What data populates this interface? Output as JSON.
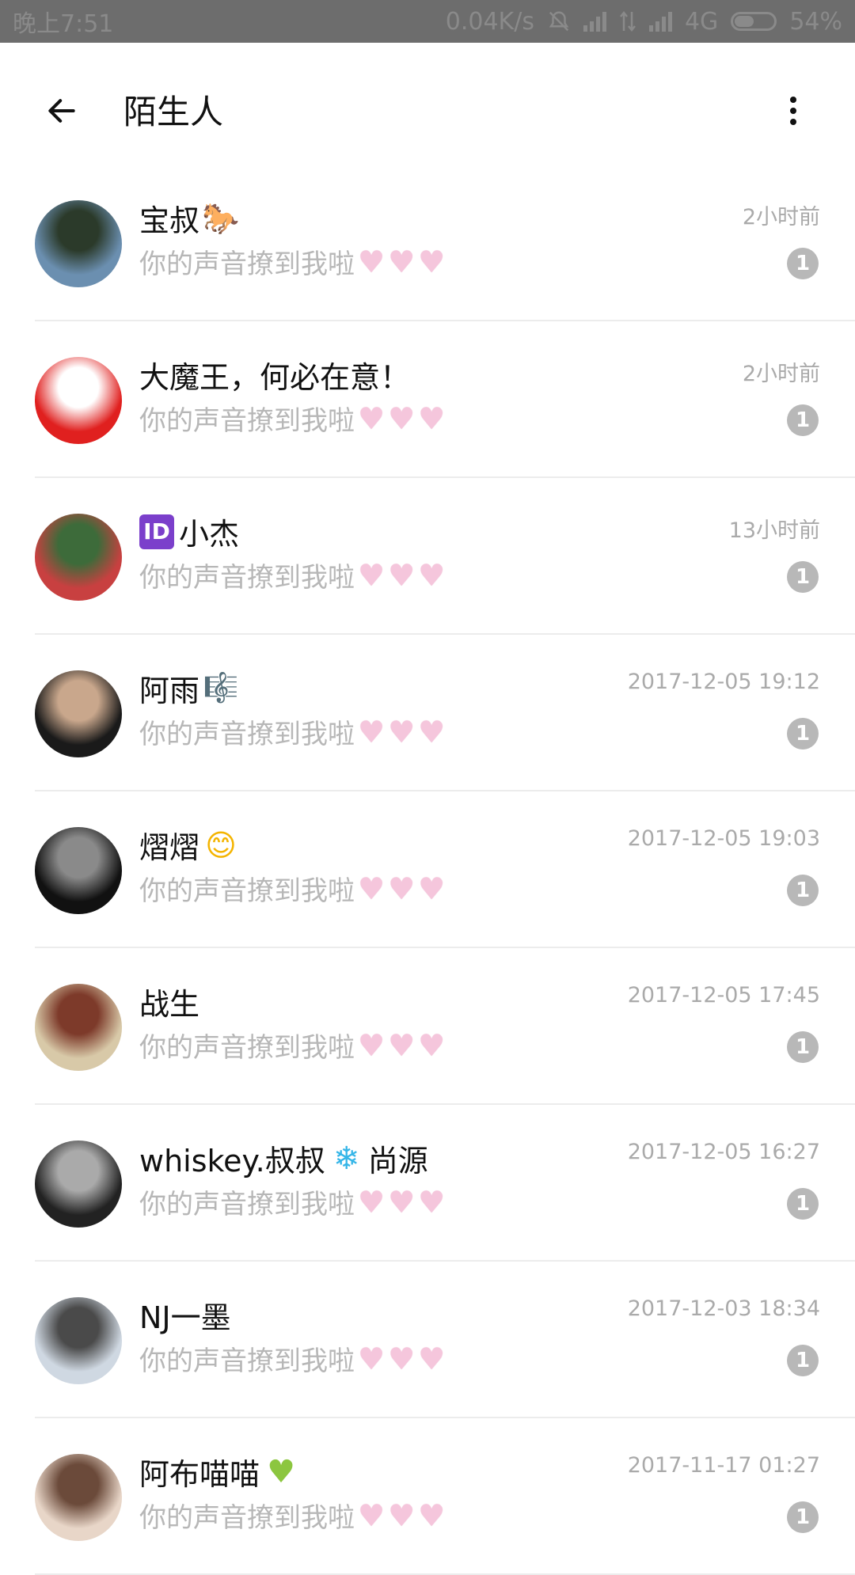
{
  "status_bar": {
    "time": "晚上7:51",
    "net_speed": "0.04K/s",
    "network_type": "4G",
    "battery_percent": "54%",
    "battery_level": 0.54
  },
  "app_bar": {
    "title": "陌生人",
    "back_icon": "arrow-left-icon",
    "more_icon": "more-vertical-icon"
  },
  "conversations": [
    {
      "name": "宝叔",
      "emoji": "🐎",
      "emoji_class": "horse",
      "message": "你的声音撩到我啦",
      "time": "2小时前",
      "unread": "1",
      "avatar_colors": [
        "#6b8fb0",
        "#2b3a2a"
      ]
    },
    {
      "name": "大魔王，何必在意！",
      "emoji": "",
      "emoji_class": "",
      "message": "你的声音撩到我啦",
      "time": "2小时前",
      "unread": "1",
      "avatar_colors": [
        "#e0201f",
        "#ffffff"
      ]
    },
    {
      "name": "小杰",
      "emoji": "ID",
      "emoji_class": "id-badge",
      "emoji_before": true,
      "message": "你的声音撩到我啦",
      "time": "13小时前",
      "unread": "1",
      "avatar_colors": [
        "#c84040",
        "#3d6b3a"
      ]
    },
    {
      "name": "阿雨",
      "emoji": "🎼",
      "emoji_class": "music",
      "message": "你的声音撩到我啦",
      "time": "2017-12-05 19:12",
      "unread": "1",
      "avatar_colors": [
        "#1a1a1a",
        "#c9a78c"
      ]
    },
    {
      "name": "熠熠",
      "emoji": "😊",
      "emoji_class": "smile",
      "message": "你的声音撩到我啦",
      "time": "2017-12-05 19:03",
      "unread": "1",
      "avatar_colors": [
        "#111111",
        "#8a8a8a"
      ]
    },
    {
      "name": "战生",
      "emoji": "",
      "emoji_class": "",
      "message": "你的声音撩到我啦",
      "time": "2017-12-05 17:45",
      "unread": "1",
      "avatar_colors": [
        "#d8c9a8",
        "#7d3a2a"
      ]
    },
    {
      "name": "whiskey.叔叔",
      "emoji": "❄",
      "emoji_class": "snow",
      "name_suffix": "尚源",
      "message": "你的声音撩到我啦",
      "time": "2017-12-05 16:27",
      "unread": "1",
      "avatar_colors": [
        "#222222",
        "#aaaaaa"
      ]
    },
    {
      "name": "NJ一墨",
      "emoji": "",
      "emoji_class": "",
      "message": "你的声音撩到我啦",
      "time": "2017-12-03 18:34",
      "unread": "1",
      "avatar_colors": [
        "#cfd8e2",
        "#4a4a4a"
      ]
    },
    {
      "name": "阿布喵喵",
      "emoji": "♥",
      "emoji_class": "green-heart",
      "message": "你的声音撩到我啦",
      "time": "2017-11-17 01:27",
      "unread": "1",
      "avatar_colors": [
        "#e8d6c8",
        "#6b4a3a"
      ]
    }
  ],
  "colors": {
    "status_bar_bg": "#6d6d6d",
    "badge_bg": "#b8b8b8",
    "heart_pink": "#f5c6dc"
  }
}
